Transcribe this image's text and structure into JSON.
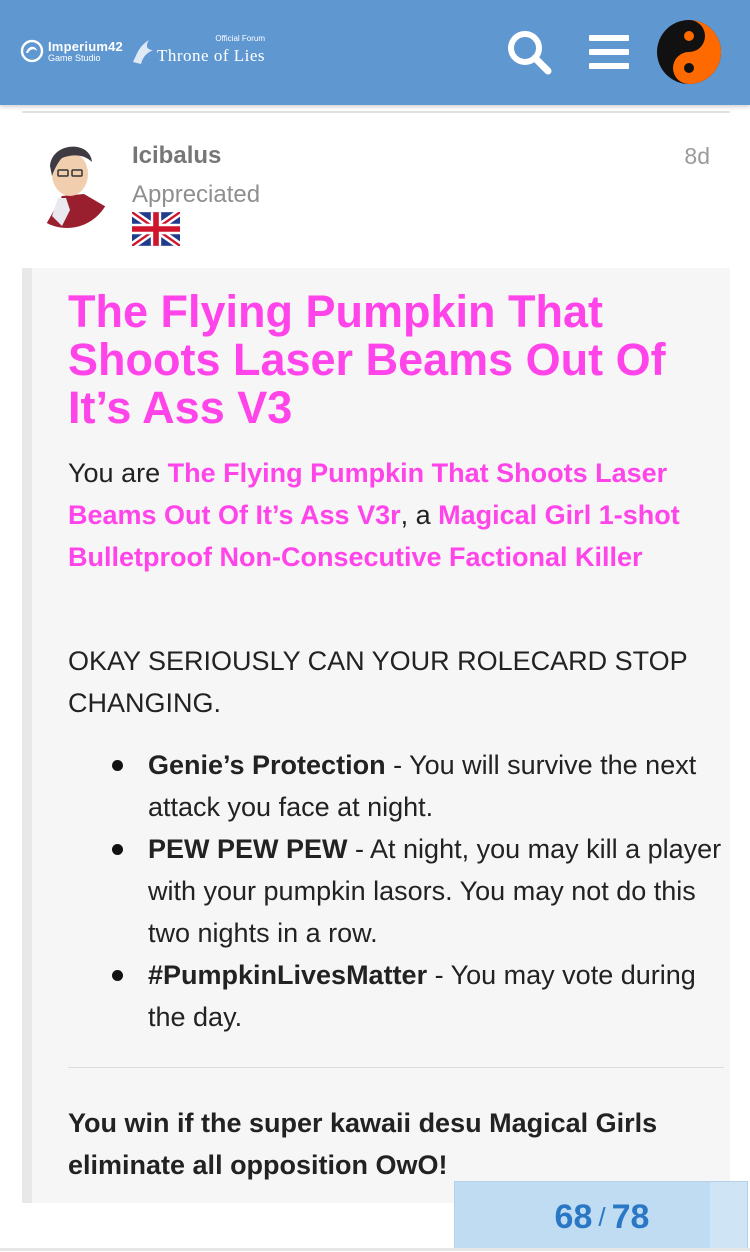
{
  "header": {
    "brand_name": "Imperium42",
    "brand_sub": "Game Studio",
    "forum_official": "Official Forum",
    "forum_title": "Throne of Lies",
    "search_icon": "search-icon",
    "menu_icon": "hamburger-menu-icon",
    "user_avatar_icon": "yin-yang-icon",
    "colors": {
      "bar": "#5f97d1",
      "icon": "#ffffff"
    }
  },
  "post": {
    "username": "Icibalus",
    "user_title": "Appreciated",
    "flag_icon": "uk-flag-icon",
    "age": "8d"
  },
  "quote": {
    "title": "The Flying Pumpkin That Shoots Laser Beams Out Of It’s Ass V3",
    "intro_prefix": "You are ",
    "intro_role": "The Flying Pumpkin That Shoots Laser Beams Out Of It’s Ass V3r",
    "intro_mid": ", a ",
    "intro_class": "Magical Girl 1-shot Bulletproof Non-Consecutive Factional Killer",
    "warning": "OKAY SERIOUSLY CAN YOUR ROLECARD STOP CHANGING.",
    "abilities": [
      {
        "name": "Genie’s Protection",
        "desc": " - You will survive the next attack you face at night."
      },
      {
        "name": "PEW PEW PEW",
        "desc": " - At night, you may kill a player with your pumpkin lasors. You may not do this two nights in a row."
      },
      {
        "name": "#PumpkinLivesMatter",
        "desc": " - You may vote during the day."
      }
    ],
    "win_condition": "You win if the super kawaii desu Magical Girls eliminate all opposition OwO!",
    "colors": {
      "highlight": "#ff44ea"
    }
  },
  "progress": {
    "current": "68",
    "separator": "/",
    "total": "78",
    "fraction": 0.872
  }
}
